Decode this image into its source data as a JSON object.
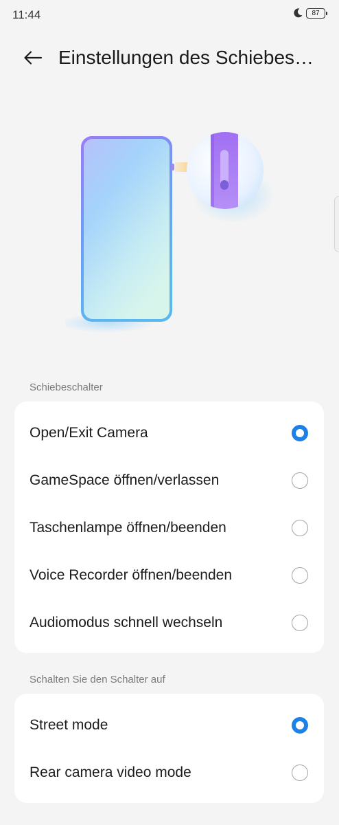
{
  "status_bar": {
    "time": "11:44",
    "battery": "87",
    "icons": [
      "moon-icon",
      "battery-icon"
    ]
  },
  "header": {
    "title": "Einstellungen des Schiebeschalters",
    "back_icon": "arrow-left-icon"
  },
  "sections": [
    {
      "label": "Schiebeschalter",
      "options": [
        {
          "label": "Open/Exit Camera",
          "selected": true
        },
        {
          "label": "GameSpace öffnen/verlassen",
          "selected": false
        },
        {
          "label": "Taschenlampe öffnen/beenden",
          "selected": false
        },
        {
          "label": "Voice Recorder öffnen/beenden",
          "selected": false
        },
        {
          "label": "Audiomodus schnell wechseln",
          "selected": false
        }
      ]
    },
    {
      "label": "Schalten Sie den Schalter auf",
      "options": [
        {
          "label": "Street mode",
          "selected": true
        },
        {
          "label": "Rear camera video mode",
          "selected": false
        }
      ]
    }
  ],
  "colors": {
    "accent": "#1d81e6",
    "background": "#f4f4f4",
    "card": "#ffffff",
    "section_label": "#7b7b7b"
  }
}
